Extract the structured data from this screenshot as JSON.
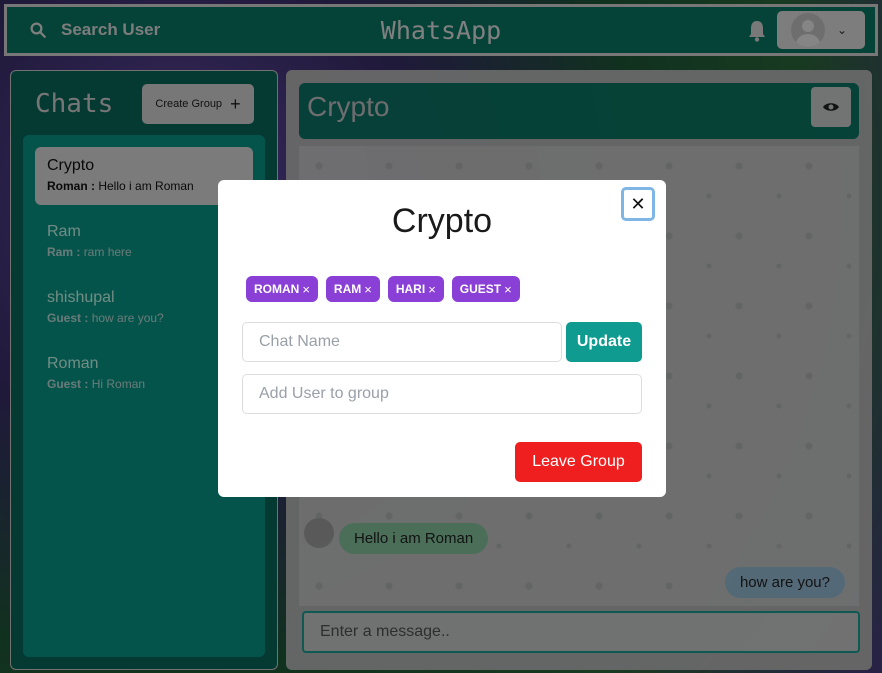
{
  "header": {
    "search_label": "Search User",
    "app_title": "WhatsApp"
  },
  "sidebar": {
    "title": "Chats",
    "create_group_label": "Create Group",
    "chats": [
      {
        "name": "Crypto",
        "sender": "Roman :",
        "preview": "Hello i am Roman",
        "active": true
      },
      {
        "name": "Ram",
        "sender": "Ram :",
        "preview": "ram here",
        "active": false
      },
      {
        "name": "shishupal",
        "sender": "Guest :",
        "preview": "how are you?",
        "active": false
      },
      {
        "name": "Roman",
        "sender": "Guest :",
        "preview": "Hi Roman",
        "active": false
      }
    ]
  },
  "chat": {
    "title": "Crypto",
    "messages": [
      {
        "text": "Hello i am Roman",
        "direction": "incoming"
      },
      {
        "text": "how are you?",
        "direction": "outgoing"
      }
    ],
    "input_placeholder": "Enter a message.."
  },
  "modal": {
    "title": "Crypto",
    "members": [
      "ROMAN",
      "RAM",
      "HARI",
      "GUEST"
    ],
    "chat_name_placeholder": "Chat Name",
    "update_label": "Update",
    "add_user_placeholder": "Add User to group",
    "leave_label": "Leave Group"
  },
  "colors": {
    "primary": "#0a7a66",
    "accent_teal": "#0f9b90",
    "tag_purple": "#8a3fd6",
    "danger": "#ef1f1f"
  }
}
